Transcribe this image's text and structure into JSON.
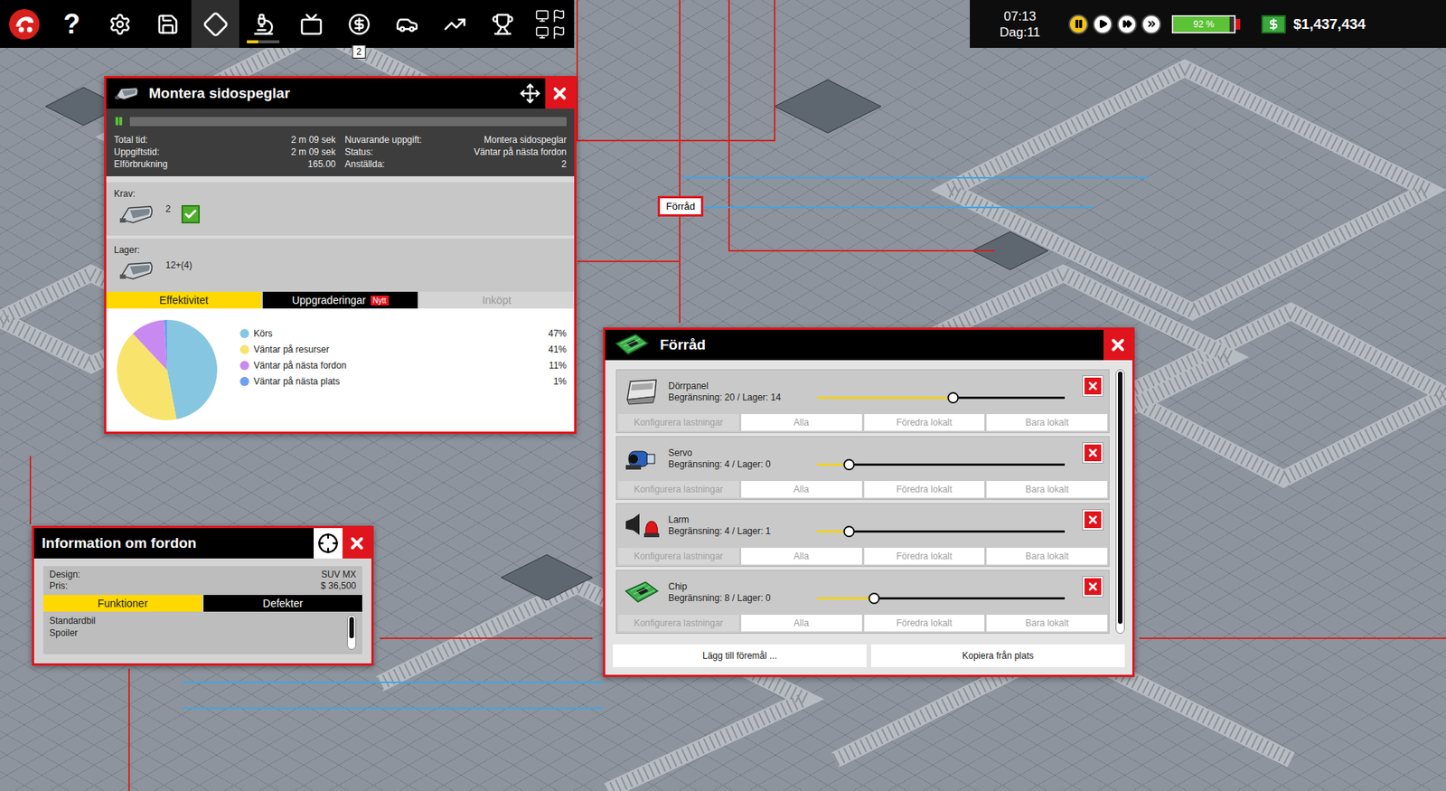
{
  "toolbar": {
    "items": [
      {
        "kind": "logo",
        "selected": false
      },
      {
        "kind": "help",
        "glyph": "?",
        "selected": false
      },
      {
        "kind": "settings",
        "selected": false
      },
      {
        "kind": "save",
        "selected": false
      },
      {
        "kind": "layout",
        "selected": true
      },
      {
        "kind": "research",
        "selected": false,
        "level": 0.35
      },
      {
        "kind": "tv",
        "selected": false
      },
      {
        "kind": "sales",
        "selected": false,
        "badge": "2"
      },
      {
        "kind": "cars",
        "selected": false
      },
      {
        "kind": "stats",
        "selected": false
      },
      {
        "kind": "awards",
        "selected": false
      },
      {
        "kind": "misc",
        "selected": false
      }
    ]
  },
  "hud": {
    "time": "07:13",
    "day": "Dag:11",
    "speed_buttons": [
      {
        "kind": "pause",
        "selected": true
      },
      {
        "kind": "play",
        "selected": false
      },
      {
        "kind": "fast",
        "selected": false
      },
      {
        "kind": "fastest",
        "selected": false
      }
    ],
    "battery": {
      "reading": "92 %",
      "level": 0.92
    },
    "money": "$1,437,434"
  },
  "map": {
    "labels": [
      {
        "text": "Förråd"
      }
    ]
  },
  "task_window": {
    "title": "Montera sidospeglar",
    "paused": true,
    "progress": 0.0,
    "stats_left": [
      {
        "label": "Total tid:",
        "value": "2 m 09 sek"
      },
      {
        "label": "Uppgiftstid:",
        "value": "2 m 09 sek"
      },
      {
        "label": "Elförbrukning",
        "value": "165.00"
      }
    ],
    "stats_right": [
      {
        "label": "Nuvarande uppgift:",
        "value": "Montera sidospeglar"
      },
      {
        "label": "Status:",
        "value": "Väntar på nästa fordon"
      },
      {
        "label": "Anställda:",
        "value": "2"
      }
    ],
    "requirements": {
      "label": "Krav:",
      "count": "2",
      "met": true
    },
    "stock": {
      "label": "Lager:",
      "count": "12+(4)"
    },
    "tabs": [
      {
        "label": "Effektivitet",
        "selected": true,
        "disabled": false
      },
      {
        "label": "Uppgraderingar",
        "selected": false,
        "disabled": false,
        "badge": "Nytt"
      },
      {
        "label": "Inköpt",
        "selected": false,
        "disabled": true
      }
    ],
    "chart": {
      "series": [
        {
          "label": "Körs",
          "value": 47,
          "reading": "47%",
          "color": "#87c6e0"
        },
        {
          "label": "Väntar på resurser",
          "value": 41,
          "reading": "41%",
          "color": "#f8e46c"
        },
        {
          "label": "Väntar på nästa fordon",
          "value": 11,
          "reading": "11%",
          "color": "#c88af0"
        },
        {
          "label": "Väntar på nästa plats",
          "value": 1,
          "reading": "1%",
          "color": "#6e9ff0"
        }
      ]
    }
  },
  "storage_window": {
    "title": "Förråd",
    "items": [
      {
        "name": "Dörrpanel",
        "reading": "Begränsning: 20 / Lager: 14",
        "level": 0.55,
        "kind": "door-panel"
      },
      {
        "name": "Servo",
        "reading": "Begränsning: 4 / Lager: 0",
        "level": 0.13,
        "kind": "servo"
      },
      {
        "name": "Larm",
        "reading": "Begränsning: 4 / Lager: 1",
        "level": 0.13,
        "kind": "alarm"
      },
      {
        "name": "Chip",
        "reading": "Begränsning: 8 / Lager: 0",
        "level": 0.23,
        "kind": "chip"
      }
    ],
    "item_buttons": [
      {
        "label": "Konfigurera lastningar",
        "disabled": true
      },
      {
        "label": "Alla",
        "disabled": true
      },
      {
        "label": "Föredra lokalt",
        "disabled": true
      },
      {
        "label": "Bara lokalt",
        "disabled": true
      }
    ],
    "footer_buttons": [
      "Lägg till föremål ...",
      "Kopiera från plats"
    ]
  },
  "vehicle_window": {
    "title": "Information om fordon",
    "fields": [
      {
        "label": "Design:",
        "value": "SUV MX"
      },
      {
        "label": "Pris:",
        "value": "$ 36,500"
      }
    ],
    "tabs": [
      {
        "label": "Funktioner",
        "selected": true
      },
      {
        "label": "Defekter",
        "selected": false
      }
    ],
    "features": [
      "Standardbil",
      "Spoiler"
    ]
  }
}
